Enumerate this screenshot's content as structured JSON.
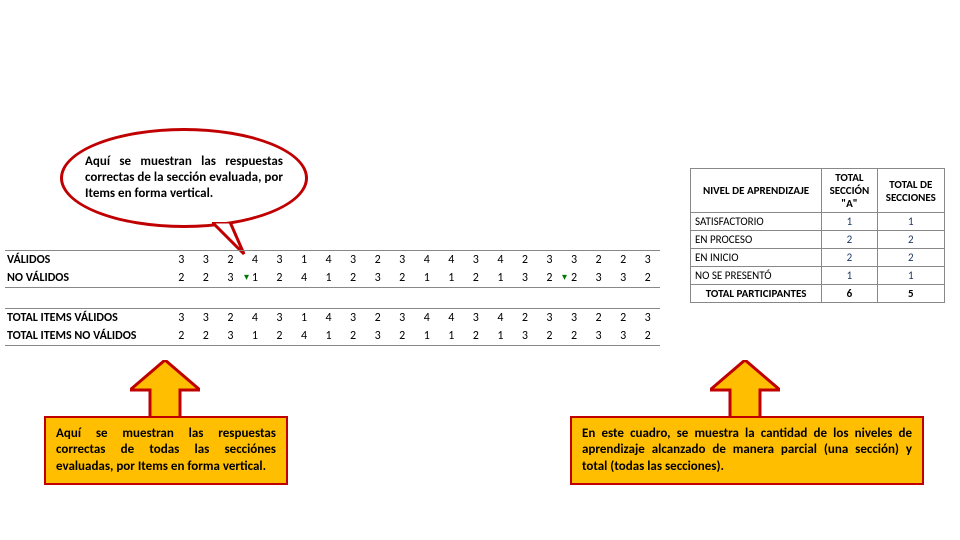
{
  "callout_top": "Aquí se muestran las respuestas correctas de la sección evaluada, por Items en forma vertical.",
  "callout_left": "Aquí se muestran las respuestas correctas de todas las secciónes evaluadas, por Items en forma vertical.",
  "callout_right": "En este cuadro, se muestra la cantidad de los niveles de aprendizaje alcanzado de manera parcial (una sección) y total (todas las secciones).",
  "items": {
    "row1_label": "VÁLIDOS",
    "row1": [
      3,
      3,
      2,
      4,
      3,
      1,
      4,
      3,
      2,
      3,
      4,
      4,
      3,
      4,
      2,
      3,
      3,
      2,
      2,
      3
    ],
    "row2_label": "NO VÁLIDOS",
    "row2": [
      2,
      2,
      3,
      1,
      2,
      4,
      1,
      2,
      3,
      2,
      1,
      1,
      2,
      1,
      3,
      2,
      2,
      3,
      3,
      2
    ],
    "row3_label": "TOTAL ITEMS VÁLIDOS",
    "row3": [
      3,
      3,
      2,
      4,
      3,
      1,
      4,
      3,
      2,
      3,
      4,
      4,
      3,
      4,
      2,
      3,
      3,
      2,
      2,
      3
    ],
    "row4_label": "TOTAL ITEMS NO VÁLIDOS",
    "row4": [
      2,
      2,
      3,
      1,
      2,
      4,
      1,
      2,
      3,
      2,
      1,
      1,
      2,
      1,
      3,
      2,
      2,
      3,
      3,
      2
    ]
  },
  "niv": {
    "h1": "NIVEL DE APRENDIZAJE",
    "h2a": "TOTAL",
    "h2b": "SECCIÓN",
    "h2c": "\"A\"",
    "h3a": "TOTAL DE",
    "h3b": "SECCIONES",
    "r1_label": "SATISFACTORIO",
    "r1_a": 1,
    "r1_b": 1,
    "r2_label": "EN PROCESO",
    "r2_a": 2,
    "r2_b": 2,
    "r3_label": "EN INICIO",
    "r3_a": 2,
    "r3_b": 2,
    "r4_label": "NO SE PRESENTÓ",
    "r4_a": 1,
    "r4_b": 1,
    "tp_label": "TOTAL PARTICIPANTES",
    "tp_a": 6,
    "tp_b": 5
  },
  "chart_data": {
    "type": "table",
    "tables": [
      {
        "title": "Respuestas por ítem — sección evaluada",
        "rows": [
          {
            "label": "VÁLIDOS",
            "values": [
              3,
              3,
              2,
              4,
              3,
              1,
              4,
              3,
              2,
              3,
              4,
              4,
              3,
              4,
              2,
              3,
              3,
              2,
              2,
              3
            ]
          },
          {
            "label": "NO VÁLIDOS",
            "values": [
              2,
              2,
              3,
              1,
              2,
              4,
              1,
              2,
              3,
              2,
              1,
              1,
              2,
              1,
              3,
              2,
              2,
              3,
              3,
              2
            ]
          }
        ]
      },
      {
        "title": "Total ítems — todas las secciones",
        "rows": [
          {
            "label": "TOTAL ITEMS VÁLIDOS",
            "values": [
              3,
              3,
              2,
              4,
              3,
              1,
              4,
              3,
              2,
              3,
              4,
              4,
              3,
              4,
              2,
              3,
              3,
              2,
              2,
              3
            ]
          },
          {
            "label": "TOTAL ITEMS NO VÁLIDOS",
            "values": [
              2,
              2,
              3,
              1,
              2,
              4,
              1,
              2,
              3,
              2,
              1,
              1,
              2,
              1,
              3,
              2,
              2,
              3,
              3,
              2
            ]
          }
        ]
      },
      {
        "title": "Nivel de aprendizaje",
        "columns": [
          "NIVEL DE APRENDIZAJE",
          "TOTAL SECCIÓN \"A\"",
          "TOTAL DE SECCIONES"
        ],
        "rows": [
          [
            "SATISFACTORIO",
            1,
            1
          ],
          [
            "EN PROCESO",
            2,
            2
          ],
          [
            "EN INICIO",
            2,
            2
          ],
          [
            "NO SE PRESENTÓ",
            1,
            1
          ],
          [
            "TOTAL PARTICIPANTES",
            6,
            5
          ]
        ]
      }
    ]
  }
}
